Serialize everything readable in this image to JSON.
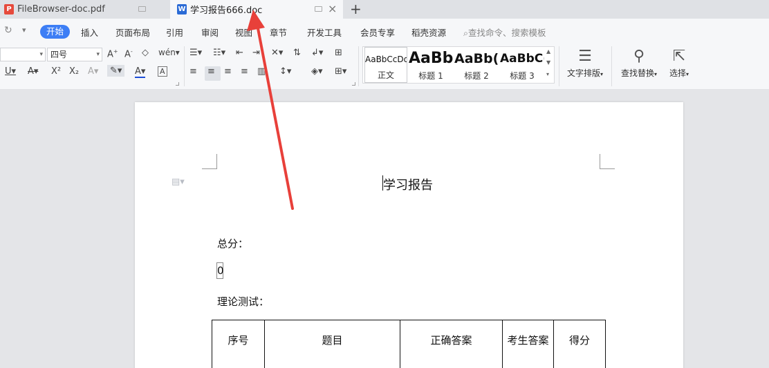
{
  "tabs": [
    {
      "label": "FileBrowser-doc.pdf",
      "icon": "pdf-file-icon"
    },
    {
      "label": "学习报告666.doc",
      "icon": "word-file-icon",
      "active": true
    }
  ],
  "menu": {
    "active": "开始",
    "items": [
      "插入",
      "页面布局",
      "引用",
      "审阅",
      "视图",
      "章节",
      "开发工具",
      "会员专享",
      "稻壳资源"
    ],
    "search_placeholder": "查找命令、搜索模板"
  },
  "ribbon": {
    "font_size": "四号",
    "styles": [
      {
        "preview": "AaBbCcDd",
        "name": "正文"
      },
      {
        "preview": "AaBb",
        "name": "标题 1"
      },
      {
        "preview": "AaBb(",
        "name": "标题 2"
      },
      {
        "preview": "AaBbC(",
        "name": "标题 3"
      }
    ],
    "text_layout": "文字排版",
    "find_replace": "查找替换",
    "select": "选择"
  },
  "document": {
    "title": "学习报告",
    "total_label": "总分：",
    "total_value": "0",
    "theory_label": "理论测试：",
    "table_headers": [
      "序号",
      "题目",
      "正确答案",
      "考生答案",
      "得分"
    ]
  },
  "colors": {
    "accent": "#3d7ef5",
    "annotation_arrow": "#e8403a"
  }
}
